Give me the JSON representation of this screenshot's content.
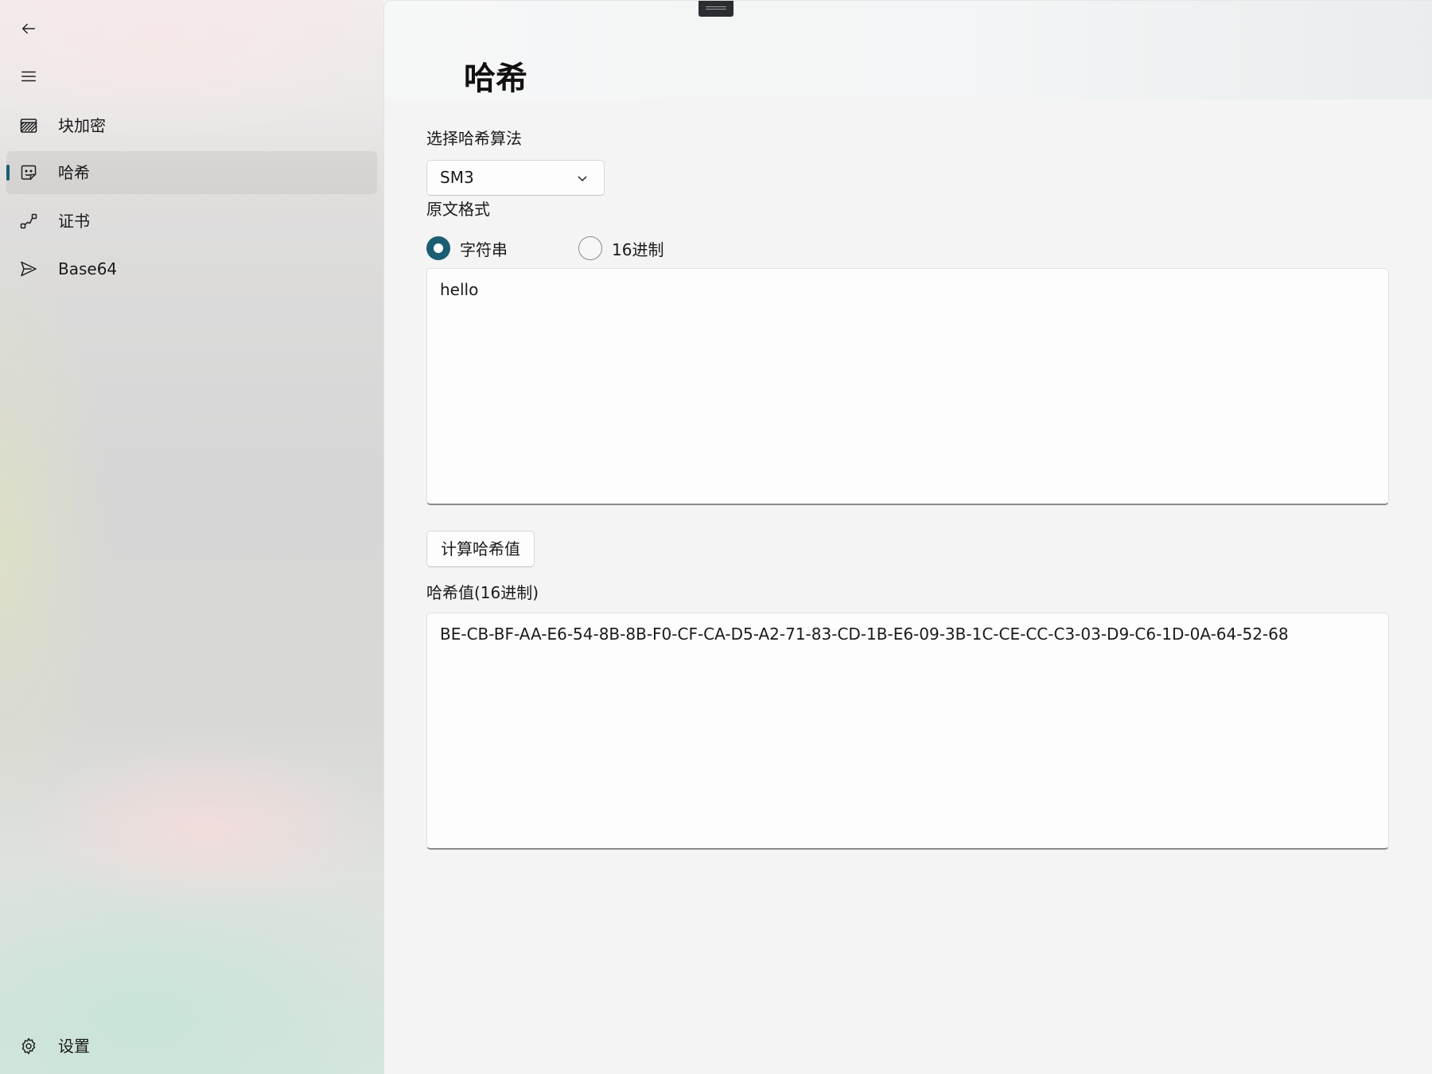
{
  "app": {
    "accent_color": "#1b5e73"
  },
  "sidebar": {
    "back_icon": "arrow-left-icon",
    "menu_icon": "hamburger-menu-icon",
    "items": [
      {
        "label": "块加密",
        "icon": "hatched-box-icon",
        "selected": false
      },
      {
        "label": "哈希",
        "icon": "sticker-icon",
        "selected": true
      },
      {
        "label": "证书",
        "icon": "connection-icon",
        "selected": false
      },
      {
        "label": "Base64",
        "icon": "send-icon",
        "selected": false
      }
    ],
    "settings": {
      "label": "设置",
      "icon": "gear-icon"
    }
  },
  "main": {
    "title": "哈希",
    "algorithm": {
      "label": "选择哈希算法",
      "selected": "SM3"
    },
    "input_format": {
      "label": "原文格式",
      "options": [
        {
          "label": "字符串",
          "checked": true
        },
        {
          "label": "16进制",
          "checked": false
        }
      ]
    },
    "input_text": "hello",
    "compute_button": "计算哈希值",
    "output": {
      "label": "哈希值(16进制)",
      "value": "BE-CB-BF-AA-E6-54-8B-8B-F0-CF-CA-D5-A2-71-83-CD-1B-E6-09-3B-1C-CE-CC-C3-03-D9-C6-1D-0A-64-52-68"
    }
  }
}
